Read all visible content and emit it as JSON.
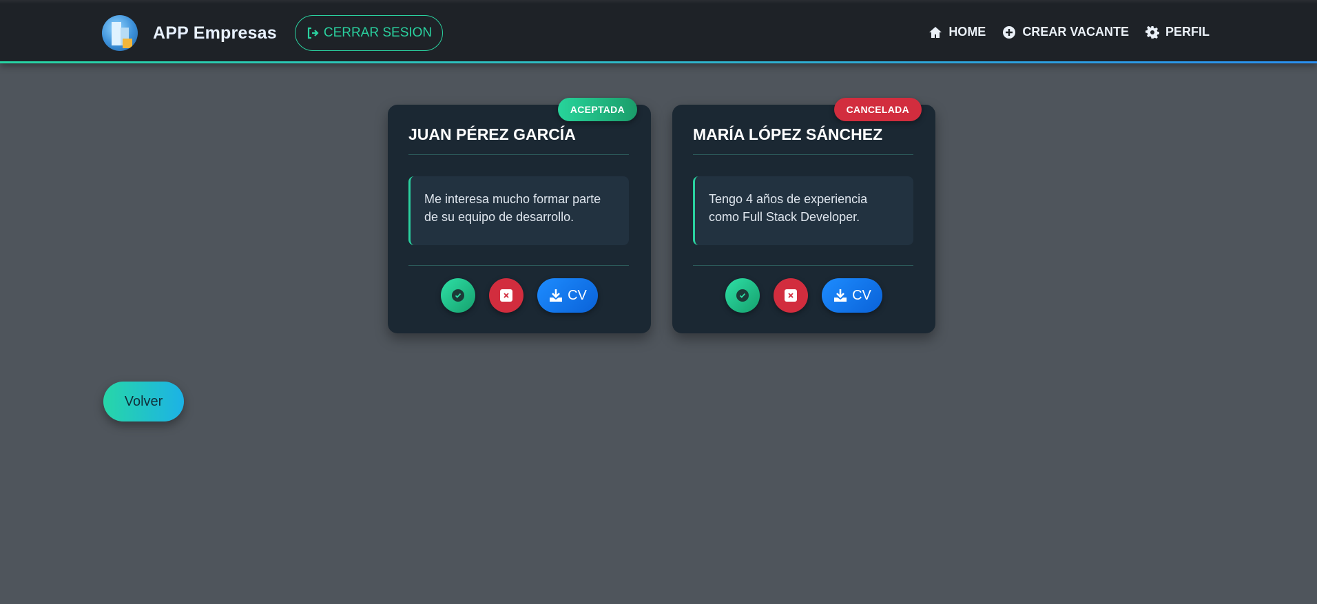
{
  "navbar": {
    "brand_name": "APP Empresas",
    "logout_label": "CERRAR SESION",
    "links": [
      {
        "label": "HOME",
        "icon": "home-icon"
      },
      {
        "label": "CREAR VACANTE",
        "icon": "plus-circle-icon"
      },
      {
        "label": "PERFIL",
        "icon": "gear-icon"
      }
    ],
    "accent_color": "#2ad19f"
  },
  "applications": [
    {
      "name": "JUAN PÉREZ GARCÍA",
      "status": "ACEPTADA",
      "status_color": "#1fb883",
      "message": "Me interesa mucho formar parte de su equipo de desarrollo.",
      "cv_label": "CV"
    },
    {
      "name": "MARÍA LÓPEZ SÁNCHEZ",
      "status": "CANCELADA",
      "status_color": "#d22d3e",
      "message": "Tengo 4 años de experiencia como Full Stack Developer.",
      "cv_label": "CV"
    }
  ],
  "back_label": "Volver"
}
